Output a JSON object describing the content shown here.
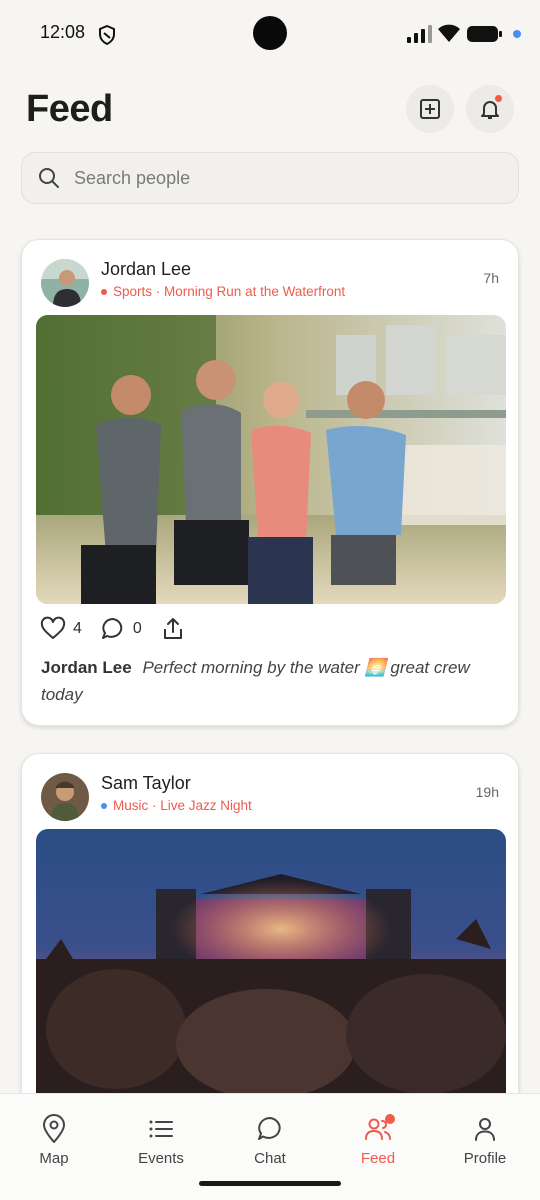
{
  "status_bar": {
    "time": "12:08"
  },
  "header": {
    "title": "Feed"
  },
  "search": {
    "placeholder": "Search people"
  },
  "posts": [
    {
      "author": "Jordan Lee",
      "category": "Sports",
      "event": "Morning Run at the Waterfront",
      "time": "7h",
      "likes": "4",
      "comments": "0",
      "caption": "Perfect morning by the water 🌅 great crew today"
    },
    {
      "author": "Sam Taylor",
      "category": "Music",
      "event": "Live Jazz Night",
      "time": "19h"
    }
  ],
  "nav": {
    "items": [
      {
        "label": "Map",
        "icon": "map-pin-icon"
      },
      {
        "label": "Events",
        "icon": "list-icon"
      },
      {
        "label": "Chat",
        "icon": "chat-icon"
      },
      {
        "label": "Feed",
        "icon": "people-icon",
        "active": true
      },
      {
        "label": "Profile",
        "icon": "person-icon"
      }
    ]
  },
  "colors": {
    "accent": "#ef5b4c",
    "music": "#4a8ef0",
    "background": "#f6f5f2"
  }
}
